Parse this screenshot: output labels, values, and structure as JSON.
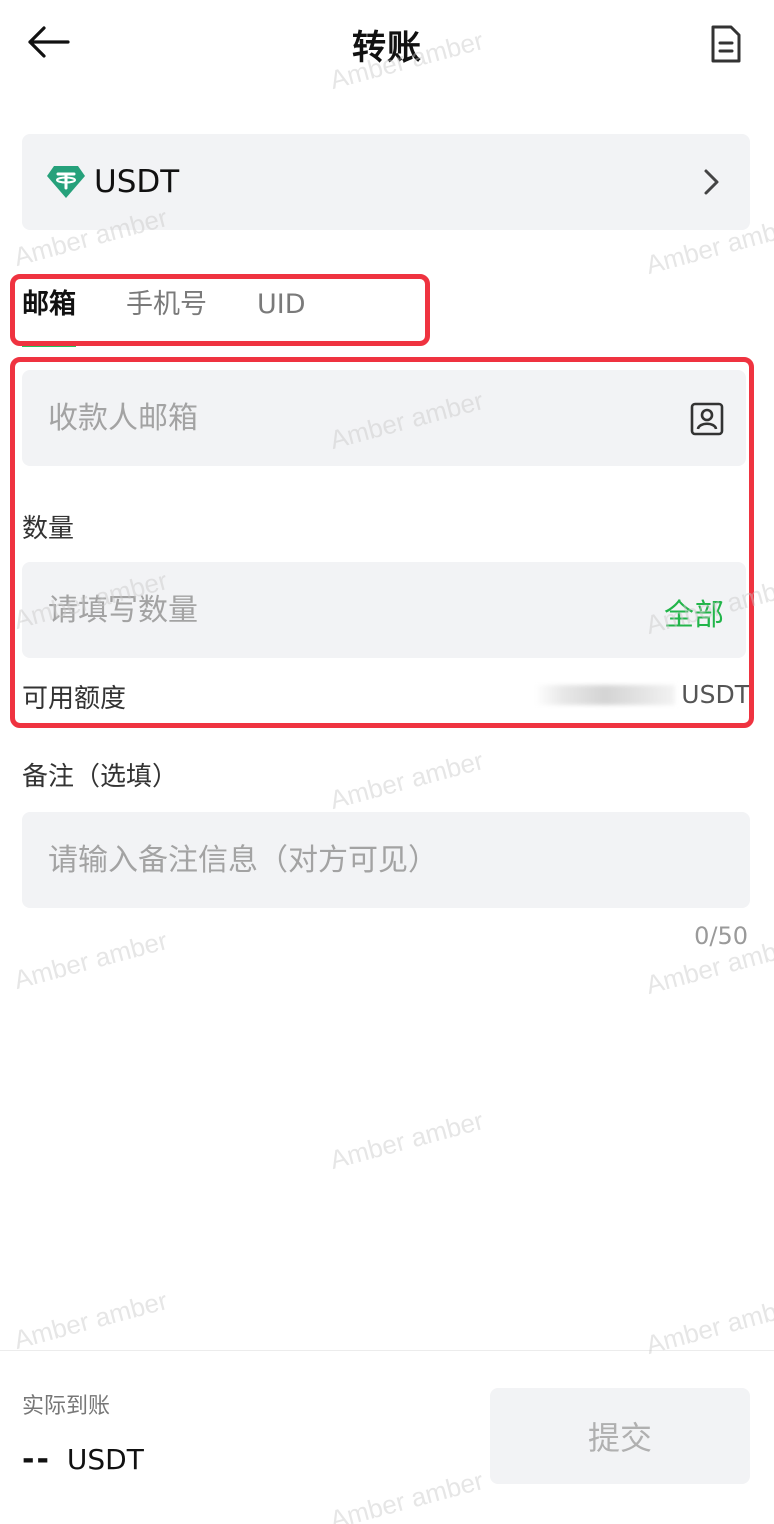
{
  "header": {
    "title": "转账",
    "back_icon": "arrow-left-icon",
    "record_icon": "document-icon"
  },
  "coin": {
    "name": "USDT",
    "icon": "tether-icon",
    "brand_color": "#26a17b"
  },
  "tabs": [
    {
      "label": "邮箱",
      "active": true
    },
    {
      "label": "手机号",
      "active": false
    },
    {
      "label": "UID",
      "active": false
    }
  ],
  "recipient": {
    "placeholder": "收款人邮箱",
    "value": "",
    "contact_icon": "contact-card-icon"
  },
  "quantity": {
    "label": "数量",
    "placeholder": "请填写数量",
    "value": "",
    "all_label": "全部"
  },
  "available": {
    "label": "可用额度",
    "unit": "USDT"
  },
  "note": {
    "label": "备注（选填）",
    "placeholder": "请输入备注信息（对方可见）",
    "value": "",
    "counter": "0/50"
  },
  "footer": {
    "actual_label": "实际到账",
    "actual_value": "--",
    "actual_unit": "USDT",
    "submit_label": "提交"
  },
  "watermark_text": "Amber amber",
  "colors": {
    "accent": "#22b54a",
    "highlight_box": "#ef3340",
    "field_bg": "#f2f3f5"
  }
}
